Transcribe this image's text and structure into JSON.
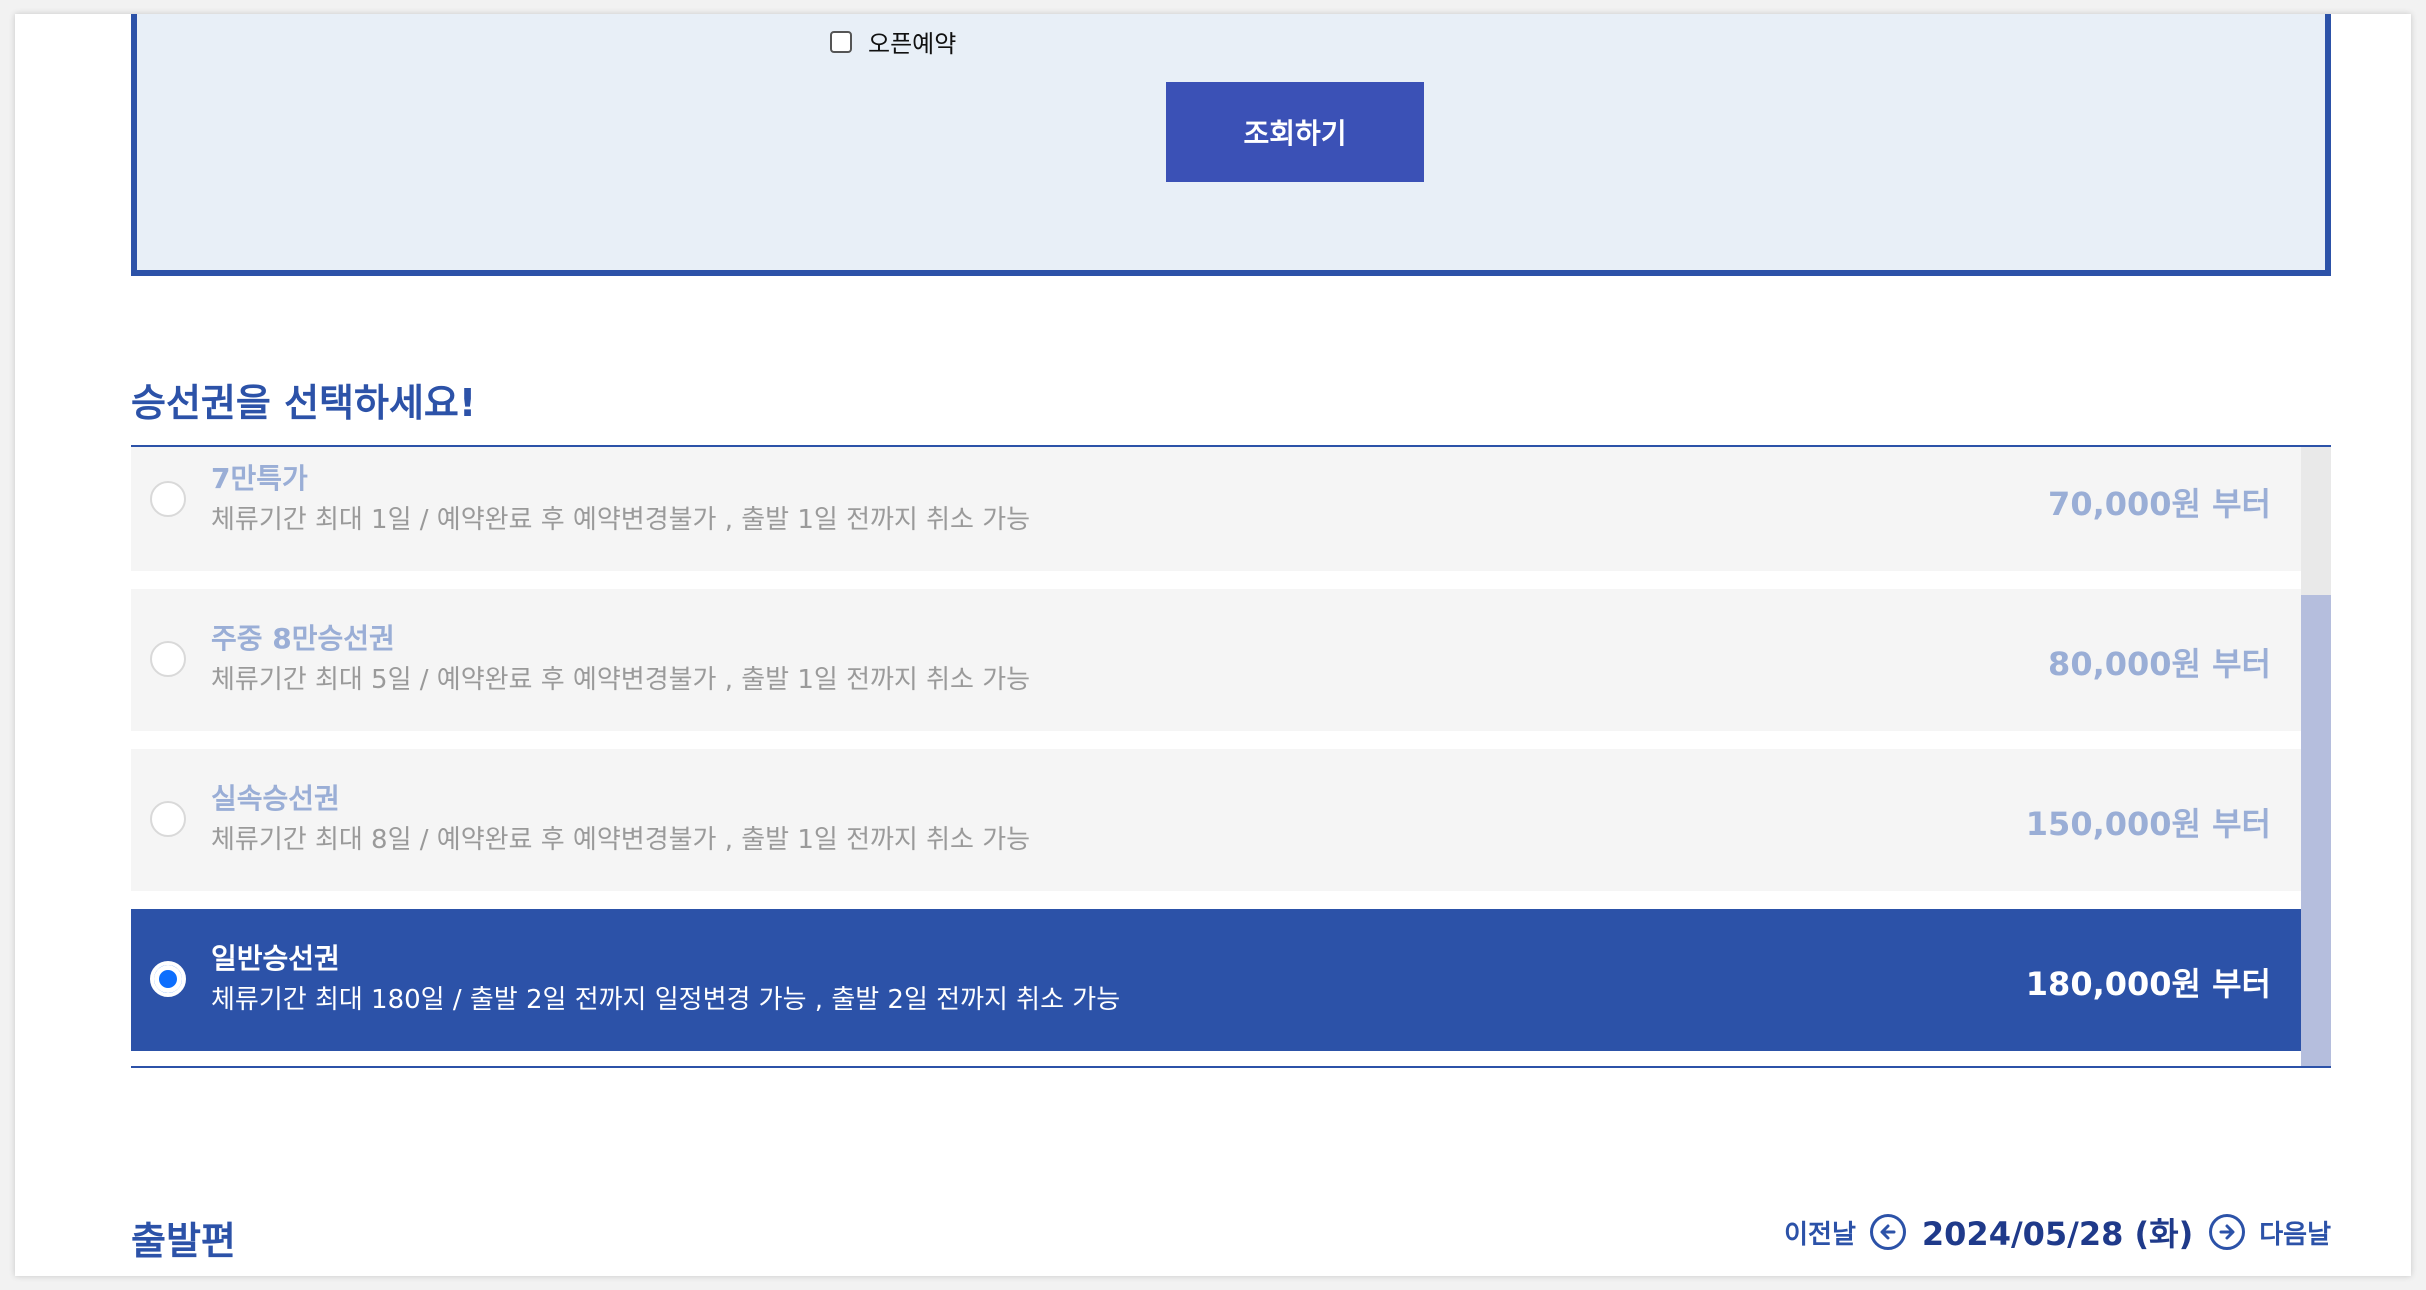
{
  "search": {
    "open_reserve_label": "오픈예약",
    "submit_label": "조회하기"
  },
  "tickets": {
    "title": "승선권을 선택하세요!",
    "items": [
      {
        "name": "7만특가",
        "desc": "체류기간 최대 1일 / 예약완료 후 예약변경불가 , 출발 1일 전까지 취소 가능",
        "price": "70,000원 부터",
        "selected": false
      },
      {
        "name": "주중 8만승선권",
        "desc": "체류기간 최대 5일 / 예약완료 후 예약변경불가 , 출발 1일 전까지 취소 가능",
        "price": "80,000원 부터",
        "selected": false
      },
      {
        "name": "실속승선권",
        "desc": "체류기간 최대 8일 / 예약완료 후 예약변경불가 , 출발 1일 전까지 취소 가능",
        "price": "150,000원 부터",
        "selected": false
      },
      {
        "name": "일반승선권",
        "desc": "체류기간 최대 180일 / 출발 2일 전까지 일정변경 가능 , 출발 2일 전까지 취소 가능",
        "price": "180,000원 부터",
        "selected": true
      }
    ]
  },
  "departure": {
    "title": "출발편",
    "prev_label": "이전날",
    "date": "2024/05/28 (화)",
    "next_label": "다음날"
  },
  "colors": {
    "brand": "#2c52a8",
    "button": "#3b51b6",
    "panel_bg": "#e8eff7"
  }
}
